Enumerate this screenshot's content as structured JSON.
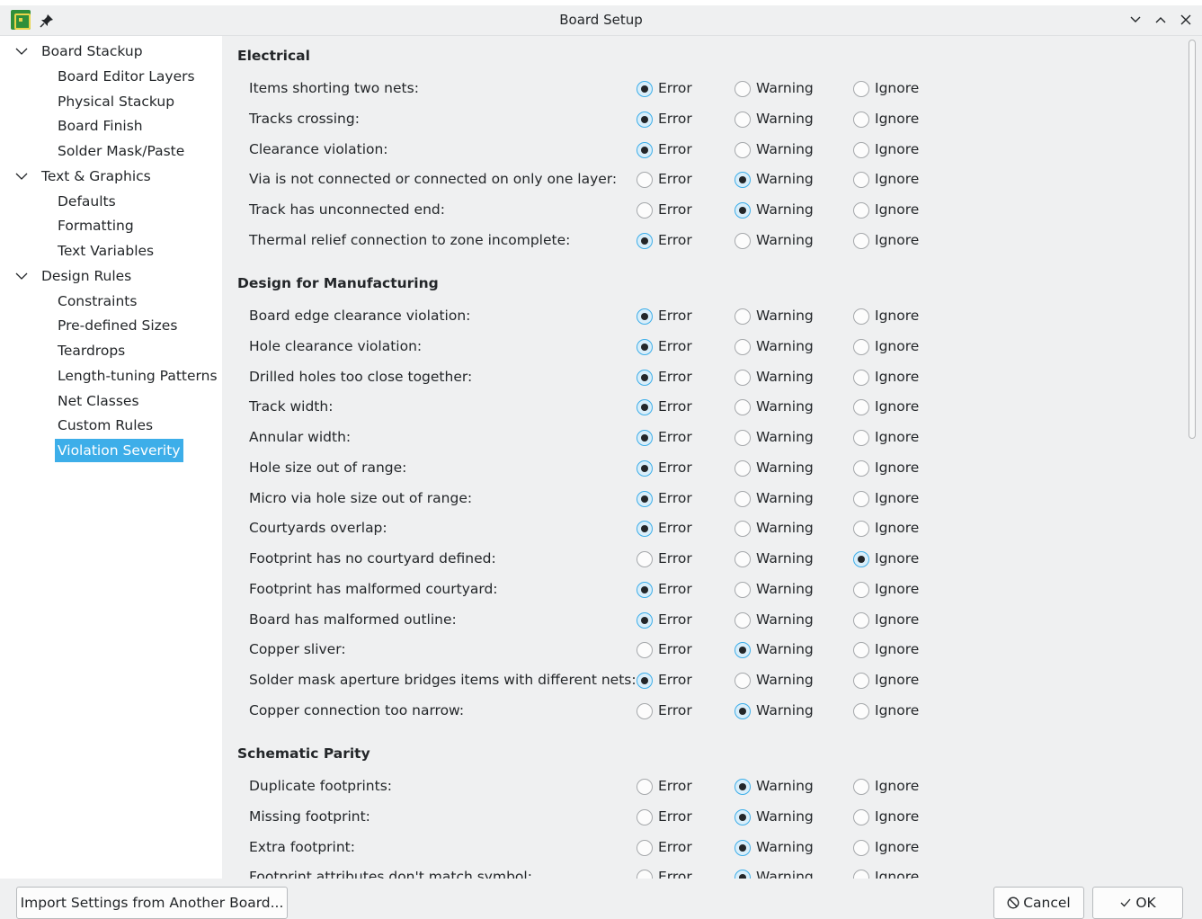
{
  "window": {
    "title": "Board Setup",
    "pin_glyph": "📌",
    "minimize_glyph": "⌄",
    "maximize_glyph": "⌃",
    "close_glyph": "✕"
  },
  "sidebar": {
    "items": [
      {
        "label": "Board Stackup",
        "level": 0,
        "expanded": true
      },
      {
        "label": "Board Editor Layers",
        "level": 1
      },
      {
        "label": "Physical Stackup",
        "level": 1
      },
      {
        "label": "Board Finish",
        "level": 1
      },
      {
        "label": "Solder Mask/Paste",
        "level": 1
      },
      {
        "label": "Text & Graphics",
        "level": 0,
        "expanded": true
      },
      {
        "label": "Defaults",
        "level": 1
      },
      {
        "label": "Formatting",
        "level": 1
      },
      {
        "label": "Text Variables",
        "level": 1
      },
      {
        "label": "Design Rules",
        "level": 0,
        "expanded": true
      },
      {
        "label": "Constraints",
        "level": 1
      },
      {
        "label": "Pre-defined Sizes",
        "level": 1
      },
      {
        "label": "Teardrops",
        "level": 1
      },
      {
        "label": "Length-tuning Patterns",
        "level": 1
      },
      {
        "label": "Net Classes",
        "level": 1
      },
      {
        "label": "Custom Rules",
        "level": 1
      },
      {
        "label": "Violation Severity",
        "level": 1,
        "selected": true
      }
    ]
  },
  "severity_options": [
    "Error",
    "Warning",
    "Ignore"
  ],
  "sections": [
    {
      "title": "Electrical",
      "rows": [
        {
          "label": "Items shorting two nets:",
          "value": "Error"
        },
        {
          "label": "Tracks crossing:",
          "value": "Error"
        },
        {
          "label": "Clearance violation:",
          "value": "Error"
        },
        {
          "label": "Via is not connected or connected on only one layer:",
          "value": "Warning"
        },
        {
          "label": "Track has unconnected end:",
          "value": "Warning"
        },
        {
          "label": "Thermal relief connection to zone incomplete:",
          "value": "Error"
        }
      ]
    },
    {
      "title": "Design for Manufacturing",
      "rows": [
        {
          "label": "Board edge clearance violation:",
          "value": "Error"
        },
        {
          "label": "Hole clearance violation:",
          "value": "Error"
        },
        {
          "label": "Drilled holes too close together:",
          "value": "Error"
        },
        {
          "label": "Track width:",
          "value": "Error"
        },
        {
          "label": "Annular width:",
          "value": "Error"
        },
        {
          "label": "Hole size out of range:",
          "value": "Error"
        },
        {
          "label": "Micro via hole size out of range:",
          "value": "Error"
        },
        {
          "label": "Courtyards overlap:",
          "value": "Error"
        },
        {
          "label": "Footprint has no courtyard defined:",
          "value": "Ignore"
        },
        {
          "label": "Footprint has malformed courtyard:",
          "value": "Error"
        },
        {
          "label": "Board has malformed outline:",
          "value": "Error"
        },
        {
          "label": "Copper sliver:",
          "value": "Warning"
        },
        {
          "label": "Solder mask aperture bridges items with different nets:",
          "value": "Error"
        },
        {
          "label": "Copper connection too narrow:",
          "value": "Warning"
        }
      ]
    },
    {
      "title": "Schematic Parity",
      "rows": [
        {
          "label": "Duplicate footprints:",
          "value": "Warning"
        },
        {
          "label": "Missing footprint:",
          "value": "Warning"
        },
        {
          "label": "Extra footprint:",
          "value": "Warning"
        },
        {
          "label": "Footprint attributes don't match symbol:",
          "value": "Warning"
        }
      ]
    }
  ],
  "buttons": {
    "import_label": "Import Settings from Another Board...",
    "cancel_label": "Cancel",
    "ok_label": "OK"
  },
  "colors": {
    "accent": "#3daee9",
    "window_bg": "#eff0f1"
  }
}
